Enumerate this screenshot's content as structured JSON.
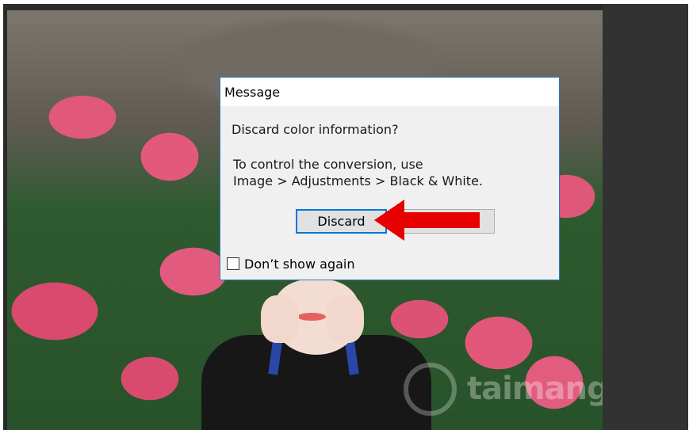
{
  "dialog": {
    "title": "Message",
    "question": "Discard color information?",
    "hint_line1": "To control the conversion, use",
    "hint_line2": "Image > Adjustments > Black & White.",
    "discard_label": "Discard",
    "cancel_label": "",
    "dont_show_label": "Don’t show again",
    "dont_show_checked": false
  },
  "watermark": {
    "text": "taimang"
  },
  "colors": {
    "dialog_border": "#2b79d3",
    "default_button_border": "#0078d7",
    "arrow": "#e60000"
  },
  "icons": {
    "annotation_arrow": "red-arrow-left-icon",
    "watermark_logo": "watermark-logo-icon"
  }
}
